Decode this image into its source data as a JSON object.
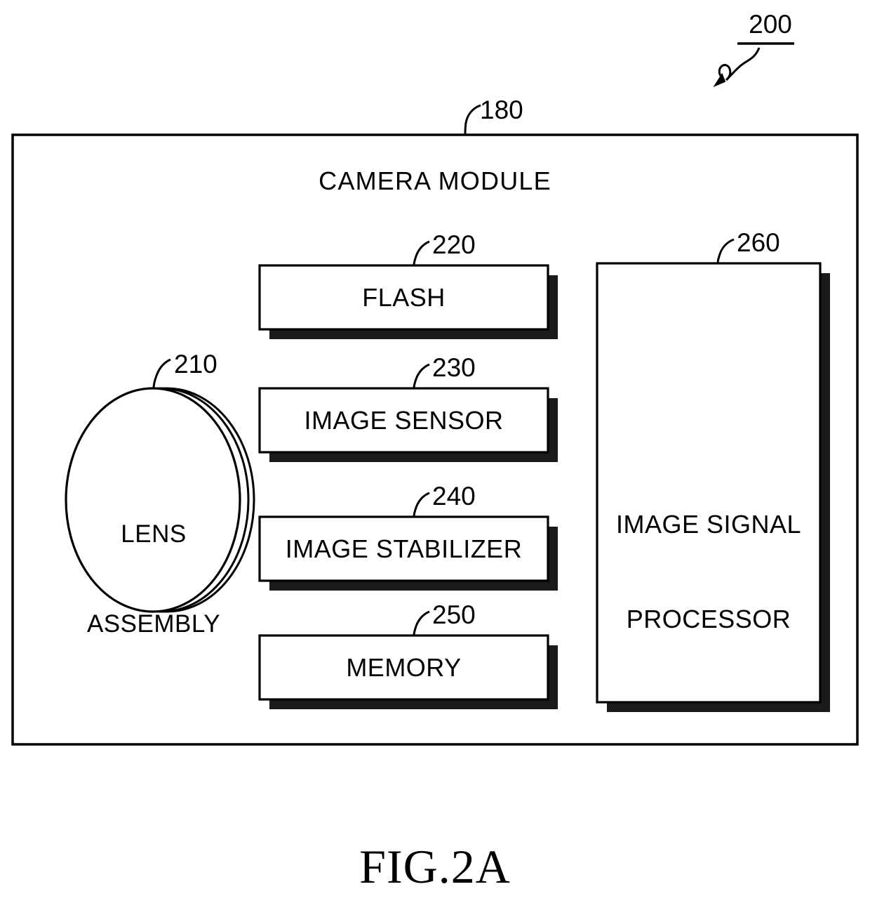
{
  "figure": {
    "caption": "FIG.2A",
    "top_reference": "200"
  },
  "diagram": {
    "outer_block": {
      "reference": "180",
      "title": "CAMERA MODULE"
    },
    "components": [
      {
        "reference": "210",
        "label": "LENS ASSEMBLY",
        "label_line1": "LENS",
        "label_line2": "ASSEMBLY",
        "shape": "lens-ellipse"
      },
      {
        "reference": "220",
        "label": "FLASH",
        "shape": "shadowed-box"
      },
      {
        "reference": "230",
        "label": "IMAGE SENSOR",
        "shape": "shadowed-box"
      },
      {
        "reference": "240",
        "label": "IMAGE STABILIZER",
        "shape": "shadowed-box"
      },
      {
        "reference": "250",
        "label": "MEMORY",
        "shape": "shadowed-box"
      },
      {
        "reference": "260",
        "label": "IMAGE SIGNAL PROCESSOR",
        "label_line1": "IMAGE SIGNAL",
        "label_line2": "PROCESSOR",
        "shape": "shadowed-box-tall"
      }
    ]
  },
  "style": {
    "stroke": "#000000",
    "background": "#ffffff",
    "shadow": "#1a1a1a"
  }
}
